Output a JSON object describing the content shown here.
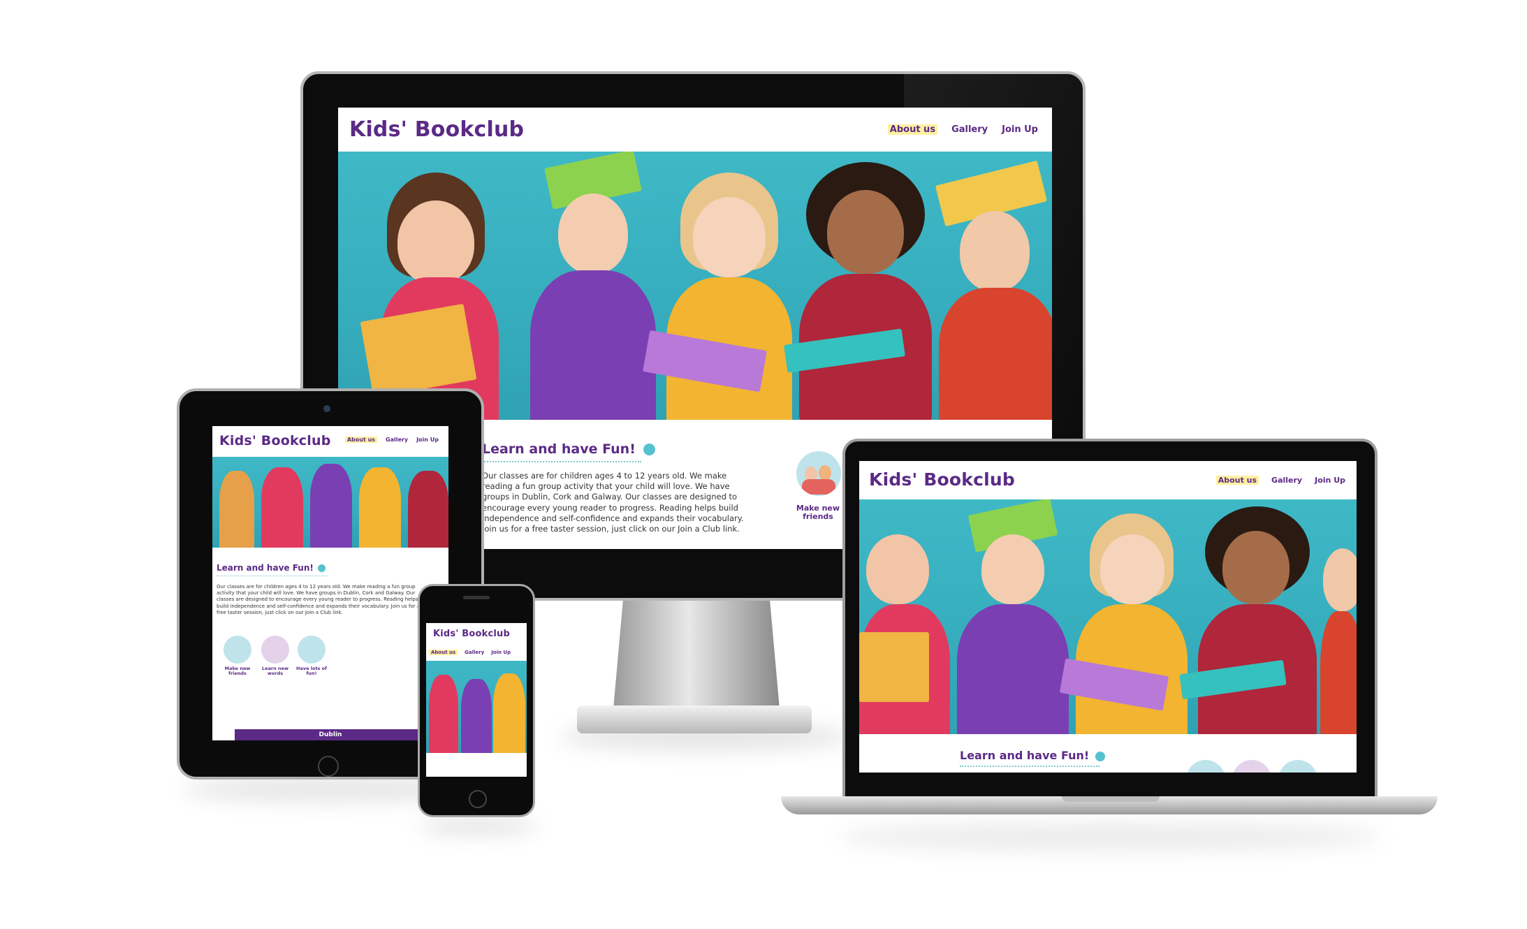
{
  "site": {
    "brand": "Kids' Bookclub",
    "nav": [
      "About us",
      "Gallery",
      "Join Up"
    ],
    "section_title": "Learn and have Fun!",
    "paragraph": "Our classes are for children ages 4 to 12 years old. We make reading a fun group activity that your child will love. We have groups in Dublin, Cork and Galway. Our classes are designed to encourage every young reader to progress. Reading helps build independence and self-confidence and expands their vocabulary. Join us for a free taster session, just click on our Join a Club link.",
    "features": [
      "Make new friends",
      "Learn new words",
      "Have lots of fun!"
    ],
    "location_banner": "Dublin"
  },
  "colors": {
    "brand_purple": "#5b2a86",
    "active_highlight": "#fdf0a0",
    "hero_teal": "#3fb8c6",
    "dotted_underline": "#7cc7d2"
  },
  "icons": [
    "smiley-icon",
    "friends-icon",
    "words-icon",
    "fun-icon"
  ]
}
